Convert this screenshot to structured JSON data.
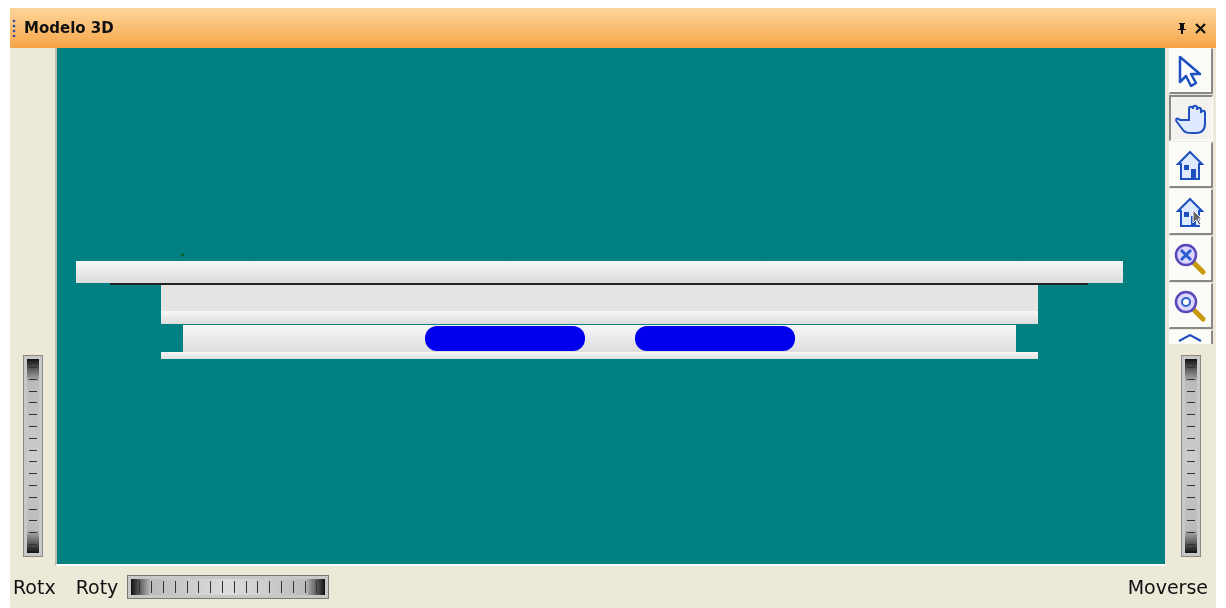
{
  "window": {
    "title": "Modelo 3D"
  },
  "toolbar": [
    {
      "kind": "pointer",
      "selected": false
    },
    {
      "kind": "hand",
      "selected": true
    },
    {
      "kind": "home",
      "selected": false
    },
    {
      "kind": "home-pointer",
      "selected": false
    },
    {
      "kind": "zoom-extents",
      "selected": false
    },
    {
      "kind": "zoom",
      "selected": false
    },
    {
      "kind": "up",
      "selected": false
    }
  ],
  "bottom_bar": {
    "labels": [
      "Rotx",
      "Roty"
    ],
    "right_label": "Moverse"
  }
}
